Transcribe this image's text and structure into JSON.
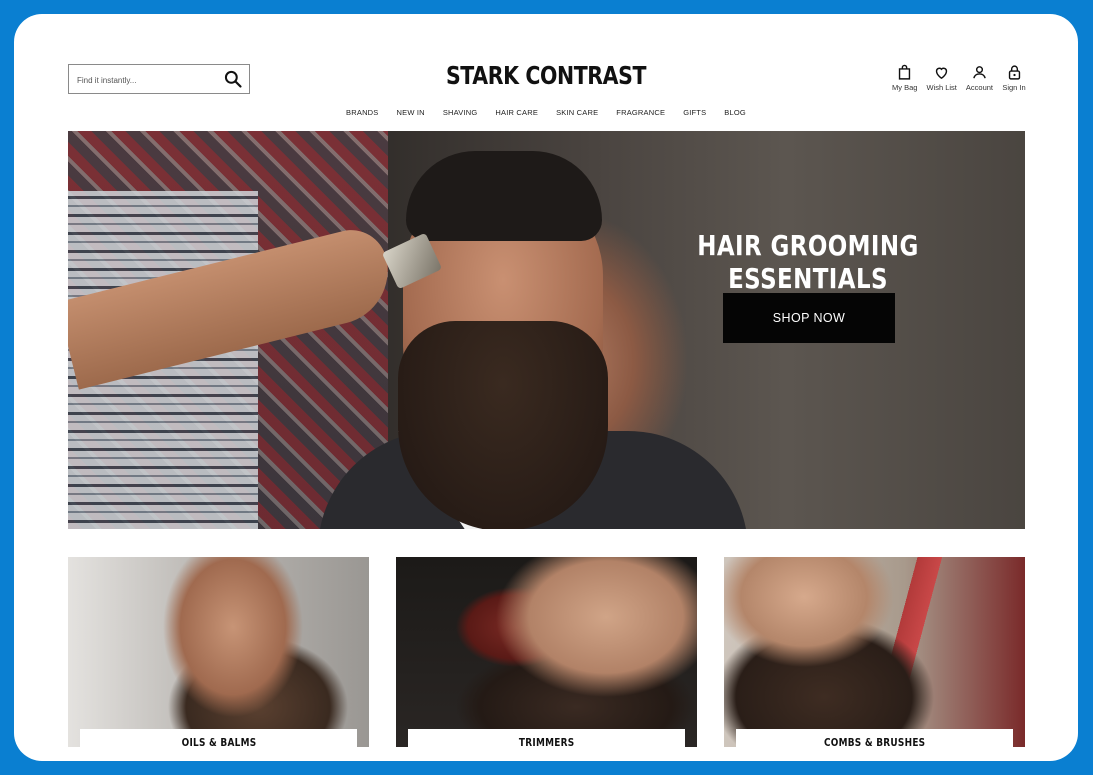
{
  "search": {
    "placeholder": "Find it instantly..."
  },
  "brand": {
    "logo": "STARK CONTRAST"
  },
  "utility_nav": [
    {
      "label": "My Bag",
      "icon": "bag-icon"
    },
    {
      "label": "Wish List",
      "icon": "heart-icon"
    },
    {
      "label": "Account",
      "icon": "user-icon"
    },
    {
      "label": "Sign In",
      "icon": "lock-icon"
    }
  ],
  "main_nav": [
    "BRANDS",
    "NEW IN",
    "SHAVING",
    "HAIR CARE",
    "SKIN CARE",
    "FRAGRANCE",
    "GIFTS",
    "BLOG"
  ],
  "hero": {
    "title": "HAIR GROOMING ESSENTIALS",
    "cta": "SHOP NOW"
  },
  "categories": [
    {
      "label": "OILS & BALMS"
    },
    {
      "label": "TRIMMERS"
    },
    {
      "label": "COMBS & BRUSHES"
    }
  ],
  "colors": {
    "page_border": "#0a7fd1",
    "cta_background": "#050505",
    "cta_text": "#ffffff"
  }
}
